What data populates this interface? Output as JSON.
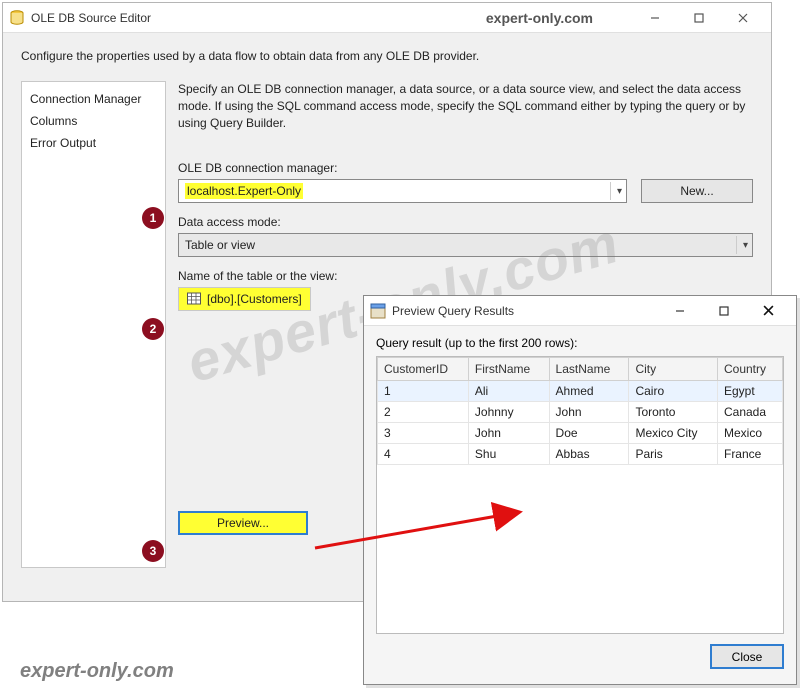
{
  "main_window": {
    "title": "OLE DB Source Editor",
    "brand": "expert-only.com",
    "intro": "Configure the properties used by a data flow to obtain data from any OLE DB provider.",
    "nav": {
      "items": [
        "Connection Manager",
        "Columns",
        "Error Output"
      ]
    },
    "content": {
      "help": "Specify an OLE DB connection manager, a data source, or a data source view, and select the data access mode. If using the SQL command access mode, specify the SQL command either by typing the query or by using Query Builder.",
      "conn_label": "OLE DB connection manager:",
      "conn_value": "localhost.Expert-Only",
      "new_btn": "New...",
      "mode_label": "Data access mode:",
      "mode_value": "Table or view",
      "table_label": "Name of the table or the view:",
      "table_value": "[dbo].[Customers]",
      "preview_btn": "Preview..."
    },
    "badges": {
      "b1": "1",
      "b2": "2",
      "b3": "3"
    }
  },
  "preview_window": {
    "title": "Preview Query Results",
    "result_label": "Query result (up to the first 200 rows):",
    "columns": [
      "CustomerID",
      "FirstName",
      "LastName",
      "City",
      "Country"
    ],
    "rows": [
      [
        "1",
        "Ali",
        "Ahmed",
        "Cairo",
        "Egypt"
      ],
      [
        "2",
        "Johnny",
        "John",
        "Toronto",
        "Canada"
      ],
      [
        "3",
        "John",
        "Doe",
        "Mexico City",
        "Mexico"
      ],
      [
        "4",
        "Shu",
        "Abbas",
        "Paris",
        "France"
      ]
    ],
    "close": "Close"
  },
  "watermark": "expert-only.com",
  "footer": "expert-only.com"
}
